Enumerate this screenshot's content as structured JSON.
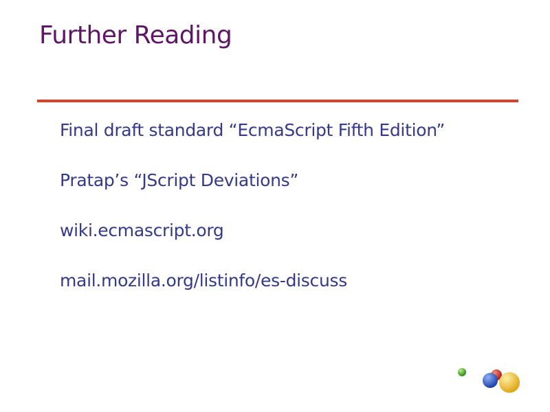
{
  "slide": {
    "title": "Further Reading",
    "items": [
      "Final draft standard “EcmaScript Fifth Edition”",
      "Pratap’s “JScript Deviations”",
      "wiki.ecmascript.org",
      "mail.mozilla.org/listinfo/es-discuss"
    ]
  },
  "colors": {
    "title": "#5f1666",
    "body_text": "#34398a",
    "rule": "#d9402c",
    "background": "#ffffff"
  },
  "logo": {
    "icon": "colored-balls-logo",
    "ball_colors": [
      "#34a020",
      "#cc1f1f",
      "#1f4fbf",
      "#f2c12e"
    ]
  }
}
